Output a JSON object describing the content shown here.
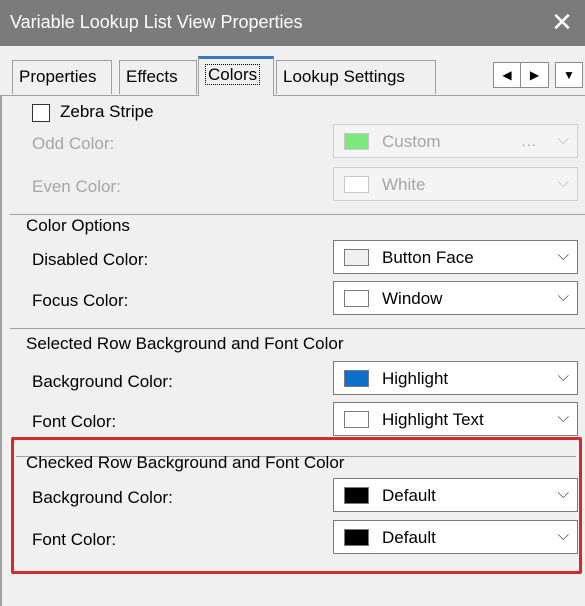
{
  "window": {
    "title": "Variable Lookup List View Properties",
    "close_glyph": "✕"
  },
  "tabs": [
    {
      "label": "Properties"
    },
    {
      "label": "Effects"
    },
    {
      "label": "Colors"
    },
    {
      "label": "Lookup Settings"
    }
  ],
  "active_tab": "Colors",
  "tab_scroll": {
    "left": "◀",
    "right": "▶",
    "menu": "▼"
  },
  "zebra": {
    "checkbox_label": "Zebra Stripe",
    "checked": false,
    "odd": {
      "label": "Odd Color:",
      "value": "Custom",
      "color": "#7de87d",
      "extra": "..."
    },
    "even": {
      "label": "Even Color:",
      "value": "White",
      "color": "#ffffff"
    }
  },
  "color_options": {
    "title": "Color Options",
    "disabled": {
      "label": "Disabled Color:",
      "value": "Button Face",
      "color": "#f0f0f0"
    },
    "focus": {
      "label": "Focus Color:",
      "value": "Window",
      "color": "#ffffff"
    }
  },
  "selected_row": {
    "title": "Selected Row Background and Font Color",
    "background": {
      "label": "Background Color:",
      "value": "Highlight",
      "color": "#0f6fcf"
    },
    "font": {
      "label": "Font Color:",
      "value": "Highlight Text",
      "color": "#ffffff"
    }
  },
  "checked_row": {
    "title": "Checked Row Background and Font Color",
    "background": {
      "label": "Background Color:",
      "value": "Default",
      "color": "#000000"
    },
    "font": {
      "label": "Font Color:",
      "value": "Default",
      "color": "#000000"
    }
  },
  "chevron_glyph": "⌵",
  "highlight_color": "#d42a2a"
}
